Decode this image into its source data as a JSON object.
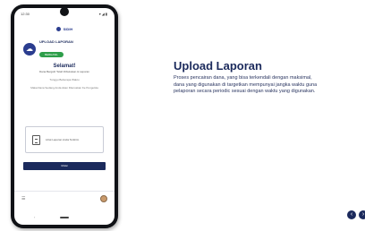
{
  "phone": {
    "status_time": "12:30",
    "status_icons": "▾◢▮",
    "app_logo": "SIDIH",
    "upload_label": "UPLOAD LAPORAN",
    "upload_status": "BERHASIL",
    "congrats_title": "Selamat!",
    "congrats_sub": "Dana Bergulir Telah Dibukukan & Laporan",
    "congrats_note": "Tunggu Beberapa Waktu",
    "congrats_note2": "Maka Dana Sedang Anda Akan Diteruskan Ke Pengelola",
    "receipt_text": "Lihat Laporan Anda Terkirim",
    "button_label": "Mulai",
    "nav_back": "‹",
    "menu_glyph": "☰",
    "cloud_glyph": "☁"
  },
  "panel": {
    "heading": "Upload Laporan",
    "description": "Proses pencairan dana, yang bisa terkendali dengan maksimal, dana yang digunakan di targetkan mempunyai jangka waktu guna pelaporan secara periodic sesuai dengan waktu yang digunakan."
  },
  "arrows": {
    "prev": "‹",
    "next": "›"
  },
  "colors": {
    "navy": "#1b2a5c",
    "success": "#2e9e4a"
  }
}
